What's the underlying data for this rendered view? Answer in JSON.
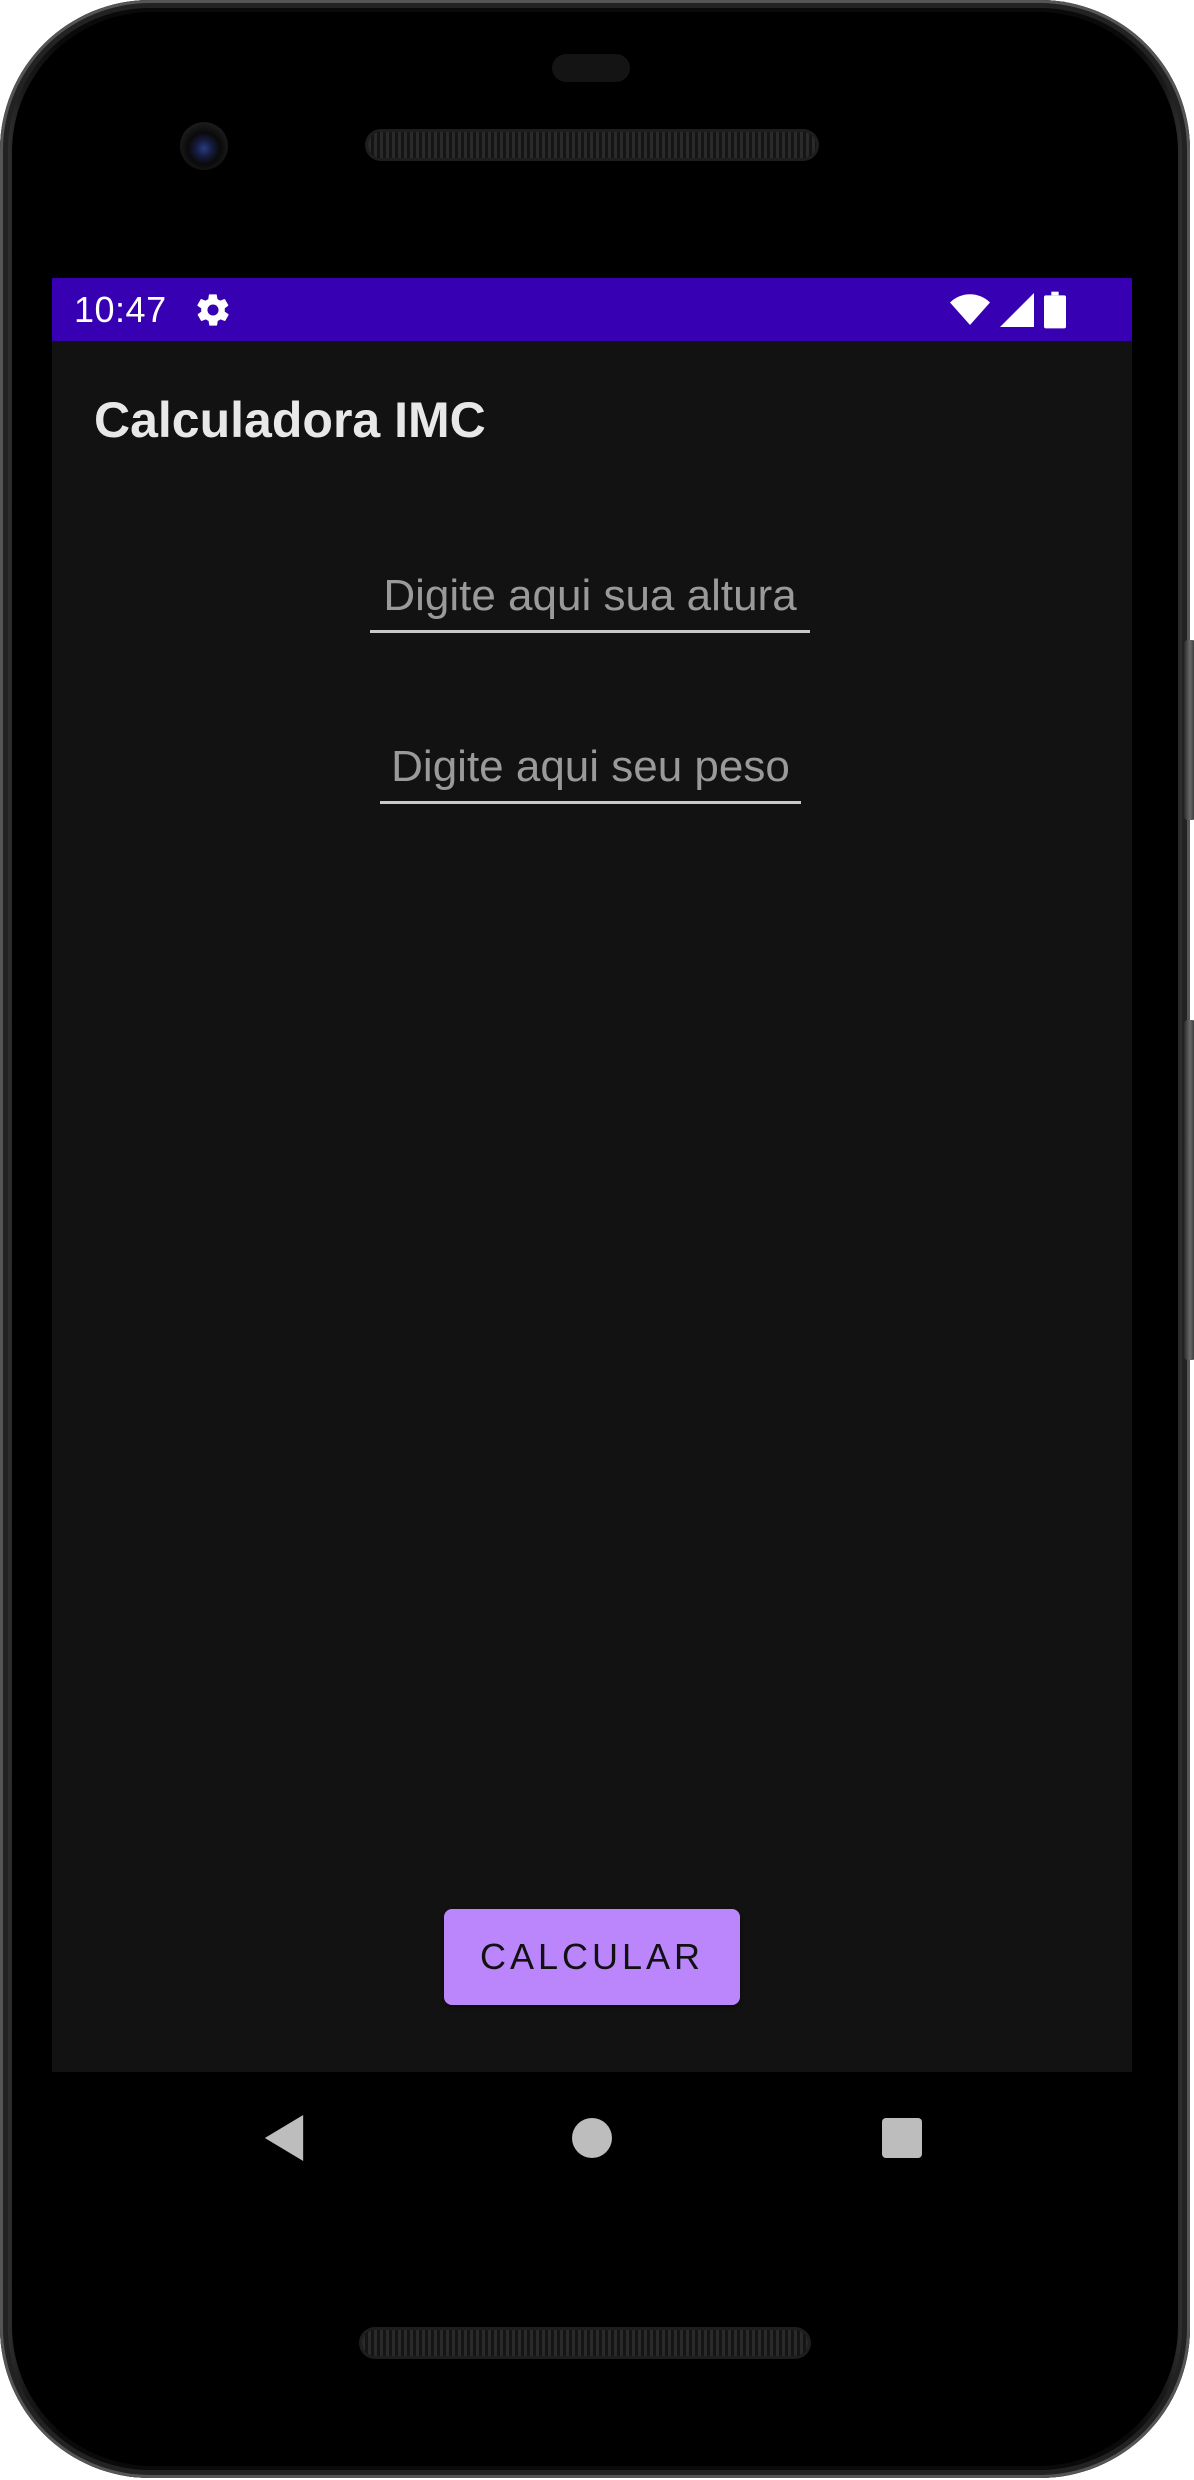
{
  "status_bar": {
    "time": "10:47",
    "icons": [
      "gear-icon",
      "wifi-icon",
      "cell-signal-icon",
      "battery-icon"
    ],
    "color": "#3700b3"
  },
  "app": {
    "title": "Calculadora IMC",
    "height_field": {
      "placeholder": "Digite aqui sua altura",
      "value": ""
    },
    "weight_field": {
      "placeholder": "Digite aqui seu peso",
      "value": ""
    },
    "calculate_button": {
      "label": "CALCULAR",
      "color": "#bb86fc"
    },
    "background": "#121212"
  },
  "nav_bar": {
    "buttons": [
      "back-icon",
      "home-icon",
      "recents-icon"
    ]
  }
}
